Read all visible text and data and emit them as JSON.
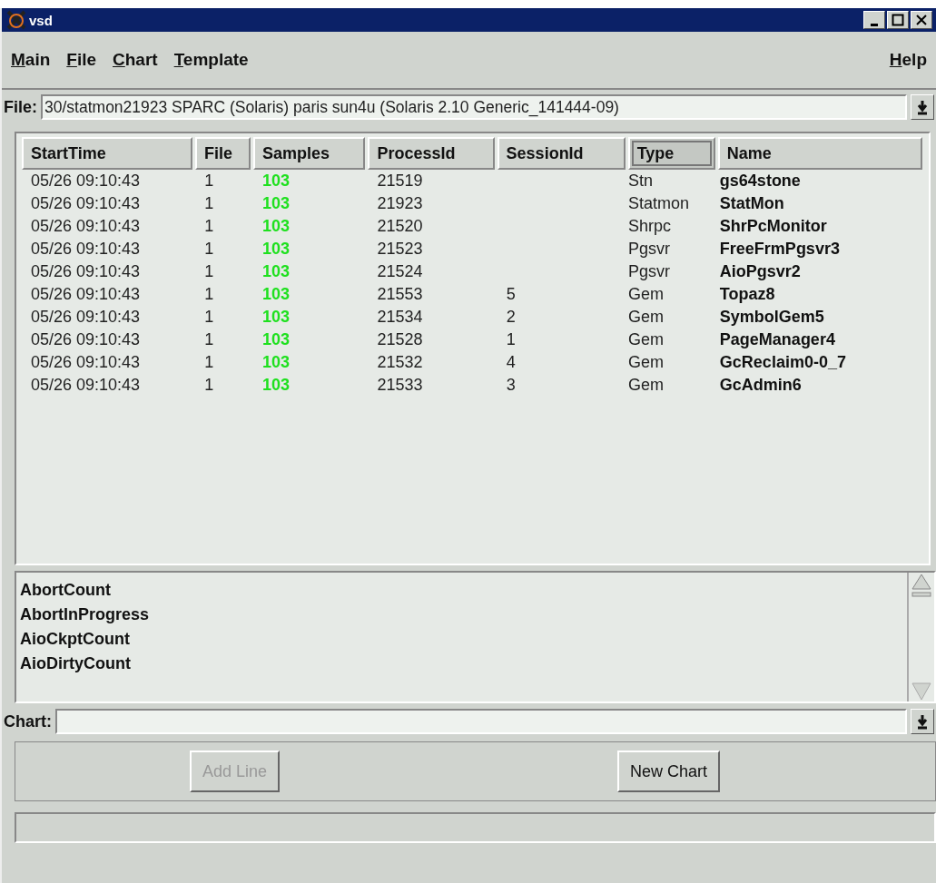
{
  "window": {
    "title": "vsd"
  },
  "menu": [
    "Main",
    "File",
    "Chart",
    "Template"
  ],
  "help_menu": "Help",
  "file_field": {
    "label": "File:",
    "value": "30/statmon21923 SPARC (Solaris) paris sun4u (Solaris 2.10 Generic_141444-09)"
  },
  "table": {
    "columns": [
      {
        "label": "StartTime",
        "selected": false
      },
      {
        "label": "File",
        "selected": false
      },
      {
        "label": "Samples",
        "selected": false
      },
      {
        "label": "ProcessId",
        "selected": false
      },
      {
        "label": "SessionId",
        "selected": false
      },
      {
        "label": "Type",
        "selected": true
      },
      {
        "label": "Name",
        "selected": false
      }
    ],
    "rows": [
      [
        "05/26 09:10:43",
        "1",
        "103",
        "21519",
        "",
        "Stn",
        "gs64stone"
      ],
      [
        "05/26 09:10:43",
        "1",
        "103",
        "21923",
        "",
        "Statmon",
        "StatMon"
      ],
      [
        "05/26 09:10:43",
        "1",
        "103",
        "21520",
        "",
        "Shrpc",
        "ShrPcMonitor"
      ],
      [
        "05/26 09:10:43",
        "1",
        "103",
        "21523",
        "",
        "Pgsvr",
        "FreeFrmPgsvr3"
      ],
      [
        "05/26 09:10:43",
        "1",
        "103",
        "21524",
        "",
        "Pgsvr",
        "AioPgsvr2"
      ],
      [
        "05/26 09:10:43",
        "1",
        "103",
        "21553",
        "5",
        "Gem",
        "Topaz8"
      ],
      [
        "05/26 09:10:43",
        "1",
        "103",
        "21534",
        "2",
        "Gem",
        "SymbolGem5"
      ],
      [
        "05/26 09:10:43",
        "1",
        "103",
        "21528",
        "1",
        "Gem",
        "PageManager4"
      ],
      [
        "05/26 09:10:43",
        "1",
        "103",
        "21532",
        "4",
        "Gem",
        "GcReclaim0-0_7"
      ],
      [
        "05/26 09:10:43",
        "1",
        "103",
        "21533",
        "3",
        "Gem",
        "GcAdmin6"
      ]
    ]
  },
  "stats": [
    "AbortCount",
    "AbortInProgress",
    "AioCkptCount",
    "AioDirtyCount"
  ],
  "chart_field": {
    "label": "Chart:"
  },
  "buttons": [
    {
      "label": "Add Line",
      "disabled": true
    },
    {
      "label": "New Chart",
      "disabled": false
    }
  ]
}
